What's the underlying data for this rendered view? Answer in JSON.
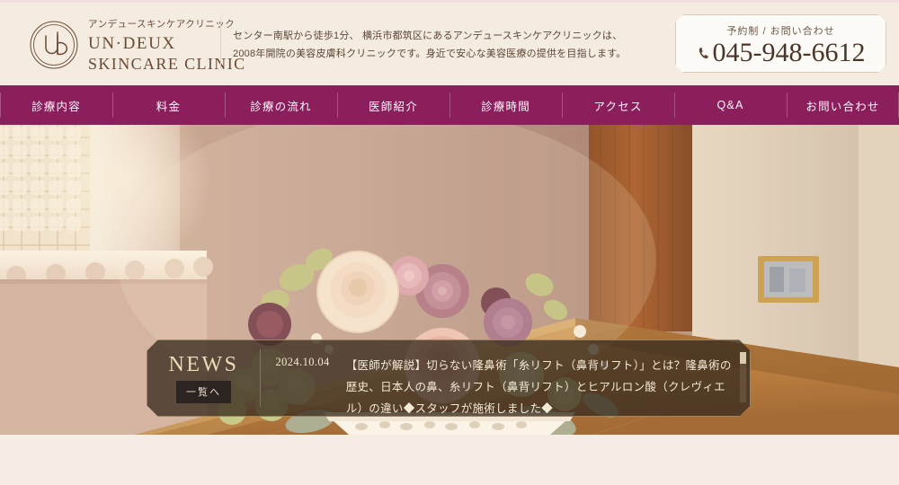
{
  "header": {
    "logo_icon": "ud-monogram-circle-logo",
    "brand_kana": "アンデュースキンケアクリニック",
    "brand_en_line1": "UN·DEUX",
    "brand_en_line2": "SKINCARE CLINIC",
    "lede_line1": "センター南駅から徒歩1分、 横浜市都筑区にあるアンデュースキンケアクリニックは、",
    "lede_line2": "2008年開院の美容皮膚科クリニックです。身近で安心な美容医療の提供を目指します。",
    "phone": {
      "label": "予約制 / お問い合わせ",
      "number": "045-948-6612",
      "icon": "phone-handset-icon"
    }
  },
  "nav": {
    "items": [
      {
        "label": "診療内容"
      },
      {
        "label": "料金"
      },
      {
        "label": "診療の流れ"
      },
      {
        "label": "医師紹介"
      },
      {
        "label": "診療時間"
      },
      {
        "label": "アクセス"
      },
      {
        "label": "Q&A"
      },
      {
        "label": "お問い合わせ"
      }
    ]
  },
  "hero": {
    "alt": "クリニック受付カウンターに置かれた花のアレンジメント"
  },
  "news": {
    "title": "NEWS",
    "list_button": "一覧へ",
    "date": "2024.10.04",
    "text": "【医師が解説】切らない隆鼻術「糸リフト（鼻背リフト）」とは？隆鼻術の歴史、日本人の鼻、糸リフト（鼻背リフト）とヒアルロン酸（クレヴィエル）の違い◆スタッフが施術しました◆"
  },
  "colors": {
    "page_background": "#f5ede3",
    "nav_background": "#8b1f5e",
    "brand_brown": "#6b4a34",
    "news_panel": "#392c1f",
    "news_gold": "#ecdcb8",
    "news_border": "#9c8565"
  }
}
